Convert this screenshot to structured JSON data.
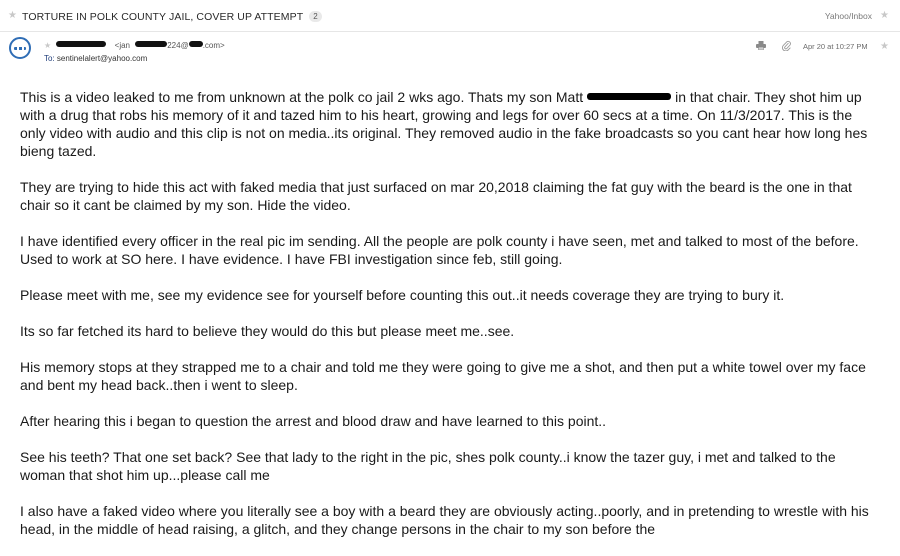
{
  "subject_bar": {
    "subject": "TORTURE IN POLK COUNTY JAIL, COVER UP ATTEMPT",
    "count": "2",
    "folder": "Yahoo/Inbox"
  },
  "header": {
    "sender_name_suffix": "<jan",
    "sender_email_mid": "224@",
    "sender_email_end": ".com>",
    "to_label": "To:",
    "to_address": "sentinelalert@yahoo.com",
    "date": "Apr 20 at 10:27 PM"
  },
  "body": {
    "p1_before": "This is a video leaked to me from unknown at the polk co jail 2 wks ago. Thats my son Matt",
    "p1_after": "in that chair. They shot him up with a drug that robs his memory of it and tazed him to his heart, growing and legs for over 60 secs at a time. On 11/3/2017. This is the only video with audio and this clip is not on media..its original. They removed audio in the fake broadcasts so you cant hear how long hes bieng tazed.",
    "p2": "They are trying to hide this act with faked media that just surfaced on mar 20,2018 claiming the fat guy with the beard is the one in that chair so it cant be claimed by my son. Hide the video.",
    "p3": "I have identified every officer in the real pic im sending. All the people are polk county i have seen, met and talked to most of the before. Used to work at SO here. I have evidence. I have FBI investigation since feb, still going.",
    "p4": "Please meet with me, see my evidence see for yourself before counting this out..it needs coverage they are trying to bury it.",
    "p5": "Its so far fetched its hard to believe they would do this but please meet me..see.",
    "p6": "His memory stops at they strapped me to a chair and told me they were going to give me a shot, and then put a white towel over my face and bent my head back..then i went to sleep.",
    "p7": "After hearing this i began to question the arrest and blood draw and have learned to this point..",
    "p8": "See his teeth? That one set back? See that lady to the right in the pic, shes polk county..i know the tazer guy, i met and talked to the woman that shot him up...please call me",
    "p9": "I also have a faked video where you literally see a boy with a beard they are obviously acting..poorly, and in pretending to wrestle with his head, in the middle of head raising, a glitch, and they change persons in the chair to my son before the"
  },
  "icons": {
    "star": "star-icon",
    "avatar": "avatar-icon",
    "print": "print-icon",
    "attachment": "paperclip-icon"
  },
  "colors": {
    "accent": "#2f6db5",
    "text": "#1a1a1a",
    "muted": "#7a7a7a"
  }
}
